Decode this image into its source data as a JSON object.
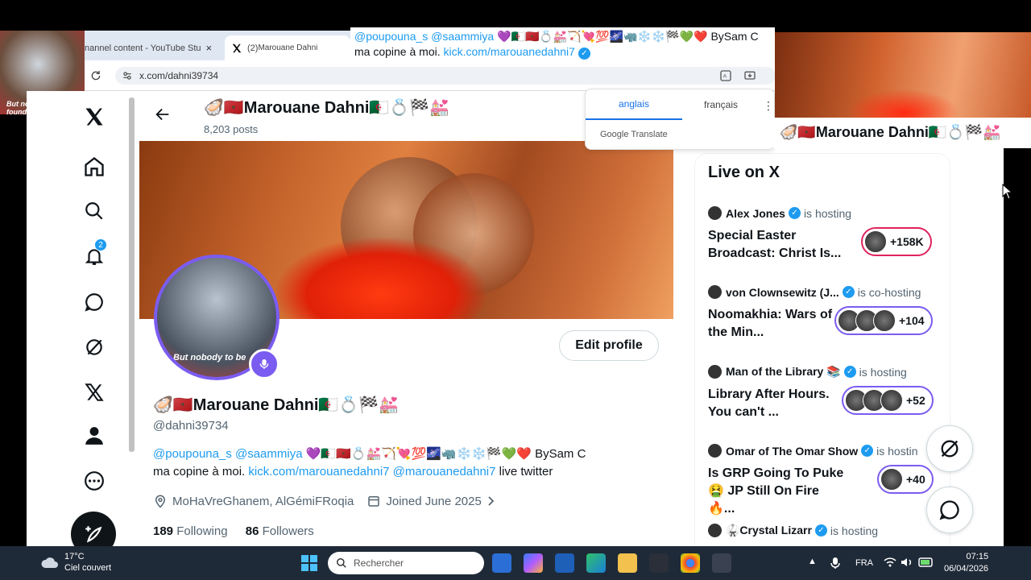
{
  "browser": {
    "tabs": [
      {
        "label": "nannel content - YouTube Stu",
        "close": "×"
      },
      {
        "label": "(2) ",
        "label2": "Marouane Dahni"
      }
    ],
    "url": "x.com/dahni39734"
  },
  "nav": {
    "notifications_count": "2"
  },
  "header": {
    "name": "🦪🇲🇦Marouane Dahni🇩🇿💍🏁💒",
    "posts": "8,203 posts"
  },
  "profile": {
    "name": "🦪🇲🇦Marouane Dahni🇩🇿💍🏁💒",
    "handle": "@dahni39734",
    "avatar_caption": "But nobody to be",
    "edit_profile": "Edit profile",
    "bio": {
      "mention1": "@poupouna_s",
      "mention2": "@saammiya",
      "emojis": "💜🇩🇿🇲🇦💍💒🏹💘💯🌌🦏❄️❄️🏁💚❤️",
      "rest1": "BySam C",
      "line2_start": "ma copine à moi.",
      "link1": "kick.com/marouanedahni7",
      "link2": "@marouanedahni7",
      "line2_end": "live twitter"
    },
    "location": "MoHaVreGhanem, AlGémiFRoqia",
    "joined": "Joined June 2025",
    "following_count": "189",
    "following_label": "Following",
    "followers_count": "86",
    "followers_label": "Followers"
  },
  "live": {
    "title": "Live on X",
    "items": [
      {
        "host": "Alex Jones",
        "status": "is hosting",
        "title": "Special Easter Broadcast: Christ Is...",
        "count": "+158K",
        "color": "#e0245e"
      },
      {
        "host": "von Clownsewitz (J...",
        "status": "is co-hosting",
        "title": "Noomakhia: Wars of the Min...",
        "count": "+104",
        "color": "#7b5cf0"
      },
      {
        "host": "Man of the Library 📚",
        "status": "is hosting",
        "title": "Library After Hours. You can't ...",
        "count": "+52",
        "color": "#7b5cf0"
      },
      {
        "host": "Omar of The Omar Show",
        "status": "is hostin",
        "title": "Is GRP Going To Puke 🤮 JP Still On Fire 🔥...",
        "count": "+40",
        "color": "#7b5cf0"
      },
      {
        "host": "🥋Crystal Lizarr",
        "status": "is hosting",
        "title": "",
        "count": "",
        "color": "#7b5cf0"
      }
    ]
  },
  "overlay": {
    "tweet_mention1": "@poupouna_s",
    "tweet_mention2": "@saammiya",
    "tweet_emojis": "💜🇩🇿🇲🇦💍💒🏹💘💯🌌🦏❄️❄️🏁💚❤️",
    "tweet_rest": "BySam C",
    "tweet_line2": "ma copine à moi.",
    "tweet_link": "kick.com/marouanedahni7",
    "name_overlay": "🦪🇲🇦Marouane Dahni🇩🇿💍🏁💒",
    "video_caption": "But nobody to be found"
  },
  "translate": {
    "lang1": "anglais",
    "lang2": "français",
    "footer": "Google Translate"
  },
  "taskbar": {
    "temp": "17°C",
    "weather": "Ciel couvert",
    "search_placeholder": "Rechercher",
    "lang": "FRA",
    "time": "07:15",
    "date": "06/04/2026"
  },
  "colors": {
    "accent": "#1d9bf0",
    "spaces_purple": "#7b5cf0",
    "taskbar_bg": "#1f2a38"
  }
}
